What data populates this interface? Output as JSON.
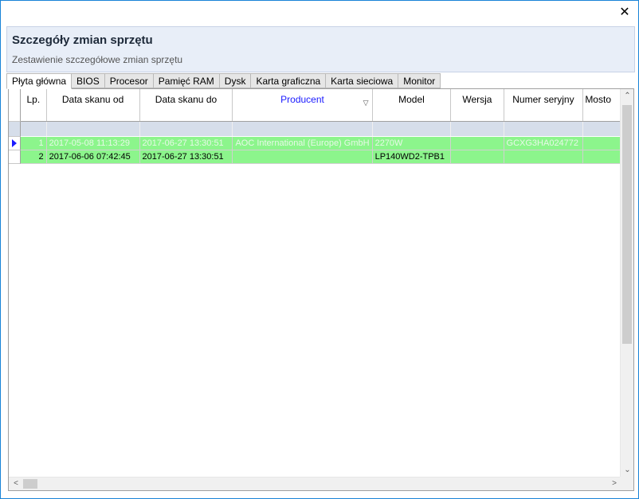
{
  "window": {
    "close_glyph": "✕"
  },
  "header": {
    "title": "Szczegóły zmian sprzętu",
    "subtitle": "Zestawienie szczegółowe zmian sprzętu"
  },
  "tabs": [
    {
      "label": "Płyta główna",
      "active": true
    },
    {
      "label": "BIOS"
    },
    {
      "label": "Procesor"
    },
    {
      "label": "Pamięć RAM"
    },
    {
      "label": "Dysk"
    },
    {
      "label": "Karta graficzna"
    },
    {
      "label": "Karta sieciowa"
    },
    {
      "label": "Monitor"
    }
  ],
  "grid": {
    "columns": [
      "Lp.",
      "Data skanu od",
      "Data skanu do",
      "Producent",
      "Model",
      "Wersja",
      "Numer seryjny",
      "Mosto"
    ],
    "sorted_column": "Producent",
    "rows": [
      [
        "1",
        "2017-05-08 11:13:29",
        "2017-06-27 13:30:51",
        "AOC International (Europe) GmbH",
        "2270W",
        "",
        "GCXG3HA024772",
        ""
      ],
      [
        "2",
        "2017-06-06 07:42:45",
        "2017-06-27 13:30:51",
        "",
        "LP140WD2-TPB1",
        "",
        "",
        ""
      ]
    ],
    "row_color": "#8cf58c",
    "filter_row_color": "#d6deea"
  },
  "scrollbars": {
    "up_arrow": "⌃",
    "down_arrow": "⌄",
    "left_arrow": "<",
    "right_arrow": ">"
  }
}
